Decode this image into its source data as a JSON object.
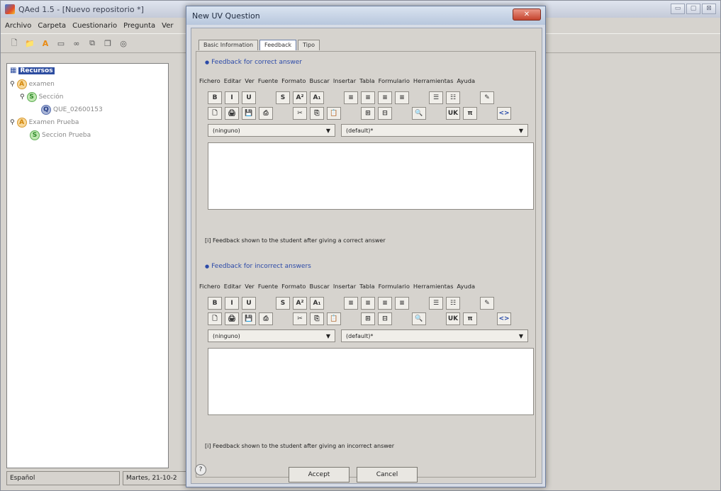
{
  "main": {
    "title": "QAed 1.5 - [Nuevo repositorio *]",
    "menu": [
      "Archivo",
      "Carpeta",
      "Cuestionario",
      "Pregunta",
      "Ver"
    ],
    "window_controls": [
      "▭",
      "▢",
      "⊠"
    ]
  },
  "tree": {
    "root": "Recursos",
    "nodes": [
      {
        "badge": "A",
        "label": "examen"
      },
      {
        "badge": "S",
        "label": "Sección"
      },
      {
        "badge": "Q",
        "label": "QUE_02600153"
      },
      {
        "badge": "A",
        "label": "Examen Prueba"
      },
      {
        "badge": "S",
        "label": "Seccion Prueba"
      }
    ]
  },
  "status": {
    "language": "Español",
    "date": "Martes, 21-10-2"
  },
  "dialog": {
    "title": "New UV Question",
    "close": "✕",
    "tabs": [
      "Basic Information",
      "Feedback",
      "Tipo"
    ],
    "correct": {
      "heading": "Feedback for correct answer",
      "hint": "[i] Feedback shown to the student after giving a correct answer"
    },
    "incorrect": {
      "heading": "Feedback for incorrect answers",
      "hint": "[i] Feedback shown to the student after giving an incorrect answer"
    },
    "editor_menu": [
      "Fichero",
      "Editar",
      "Ver",
      "Fuente",
      "Formato",
      "Buscar",
      "Insertar",
      "Tabla",
      "Formulario",
      "Herramientas",
      "Ayuda"
    ],
    "fmt_row1": [
      "B",
      "I",
      "U",
      "",
      "S",
      "A²",
      "A₁",
      "",
      "≡",
      "≡",
      "≡",
      "≡",
      "",
      "☰",
      "☷",
      "",
      "✎"
    ],
    "fmt_row2": [
      "🗋",
      "🖨",
      "💾",
      "⎙",
      "",
      "✂",
      "⎘",
      "📋",
      "",
      "⊞",
      "⊟",
      "",
      "🔍",
      "",
      "UK",
      "π",
      "",
      "<>"
    ],
    "style_select": "(ninguno)",
    "font_select": "(default)*",
    "accept": "Accept",
    "cancel": "Cancel",
    "help": "?"
  }
}
